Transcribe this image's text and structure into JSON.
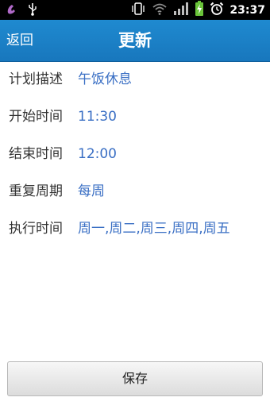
{
  "status_bar": {
    "icons": [
      "missed-call-icon",
      "usb-icon",
      "vibrate-icon",
      "wifi-icon",
      "signal-icon",
      "battery-charging-icon",
      "alarm-icon"
    ],
    "time": "23:37"
  },
  "header": {
    "back_label": "返回",
    "title": "更新",
    "color": "#1f8ad0"
  },
  "form": {
    "rows": [
      {
        "label": "计划描述",
        "value": "午饭休息"
      },
      {
        "label": "开始时间",
        "value": "11:30"
      },
      {
        "label": "结束时间",
        "value": "12:00"
      },
      {
        "label": "重复周期",
        "value": "每周"
      },
      {
        "label": "执行时间",
        "value": "周一,周二,周三,周四,周五"
      }
    ],
    "value_color": "#3a6fc4"
  },
  "footer": {
    "save_label": "保存"
  }
}
